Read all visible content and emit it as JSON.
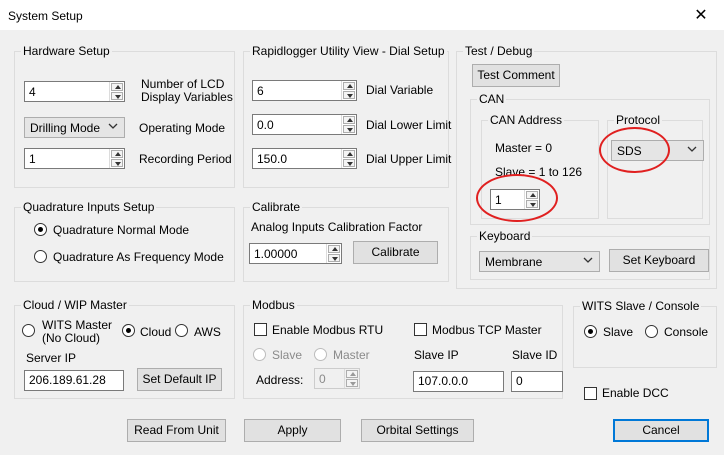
{
  "window": {
    "title": "System Setup",
    "close_glyph": "✕"
  },
  "hardware": {
    "legend": "Hardware Setup",
    "lcd_vars_value": "4",
    "lcd_vars_label_1": "Number of LCD",
    "lcd_vars_label_2": "Display Variables",
    "mode_value": "Drilling Mode",
    "mode_label": "Operating Mode",
    "period_value": "1",
    "period_label": "Recording Period"
  },
  "rapidlogger": {
    "legend": "Rapidlogger Utility View - Dial Setup",
    "dial_var_value": "6",
    "dial_var_label": "Dial Variable",
    "lower_value": "0.0",
    "lower_label": "Dial Lower Limit",
    "upper_value": "150.0",
    "upper_label": "Dial Upper Limit"
  },
  "test_debug": {
    "legend": "Test / Debug",
    "test_comment_label": "Test Comment",
    "can": {
      "legend": "CAN",
      "address_legend": "CAN Address",
      "master_text": "Master = 0",
      "slave_text": "Slave = 1 to 126",
      "address_value": "1",
      "protocol_legend": "Protocol",
      "protocol_value": "SDS"
    },
    "keyboard": {
      "legend": "Keyboard",
      "type_value": "Membrane",
      "set_keyboard_label": "Set Keyboard"
    }
  },
  "quadrature": {
    "legend": "Quadrature Inputs Setup",
    "normal_label": "Quadrature Normal Mode",
    "frequency_label": "Quadrature As Frequency Mode"
  },
  "calibrate": {
    "legend": "Calibrate",
    "factor_label": "Analog Inputs Calibration Factor",
    "factor_value": "1.00000",
    "calibrate_label": "Calibrate"
  },
  "cloud": {
    "legend": "Cloud / WIP Master",
    "wits_master_label_1": "WITS Master",
    "wits_master_label_2": "(No Cloud)",
    "cloud_label": "Cloud",
    "aws_label": "AWS",
    "server_ip_label": "Server IP",
    "server_ip_value": "206.189.61.28",
    "set_default_ip_label": "Set Default IP"
  },
  "modbus": {
    "legend": "Modbus",
    "enable_rtu_label": "Enable Modbus RTU",
    "tcp_master_label": "Modbus TCP Master",
    "slave_label": "Slave",
    "master_label": "Master",
    "address_label": "Address:",
    "address_value": "0",
    "slave_ip_label": "Slave IP",
    "slave_ip_value": "107.0.0.0",
    "slave_id_label": "Slave ID",
    "slave_id_value": "0"
  },
  "wits_slave": {
    "legend": "WITS Slave / Console",
    "slave_label": "Slave",
    "console_label": "Console",
    "enable_dcc_label": "Enable DCC"
  },
  "footer": {
    "read_label": "Read From Unit",
    "apply_label": "Apply",
    "orbital_label": "Orbital Settings",
    "cancel_label": "Cancel"
  },
  "colors": {
    "annotation_red": "#e02020",
    "default_button_blue": "#0078d7"
  }
}
